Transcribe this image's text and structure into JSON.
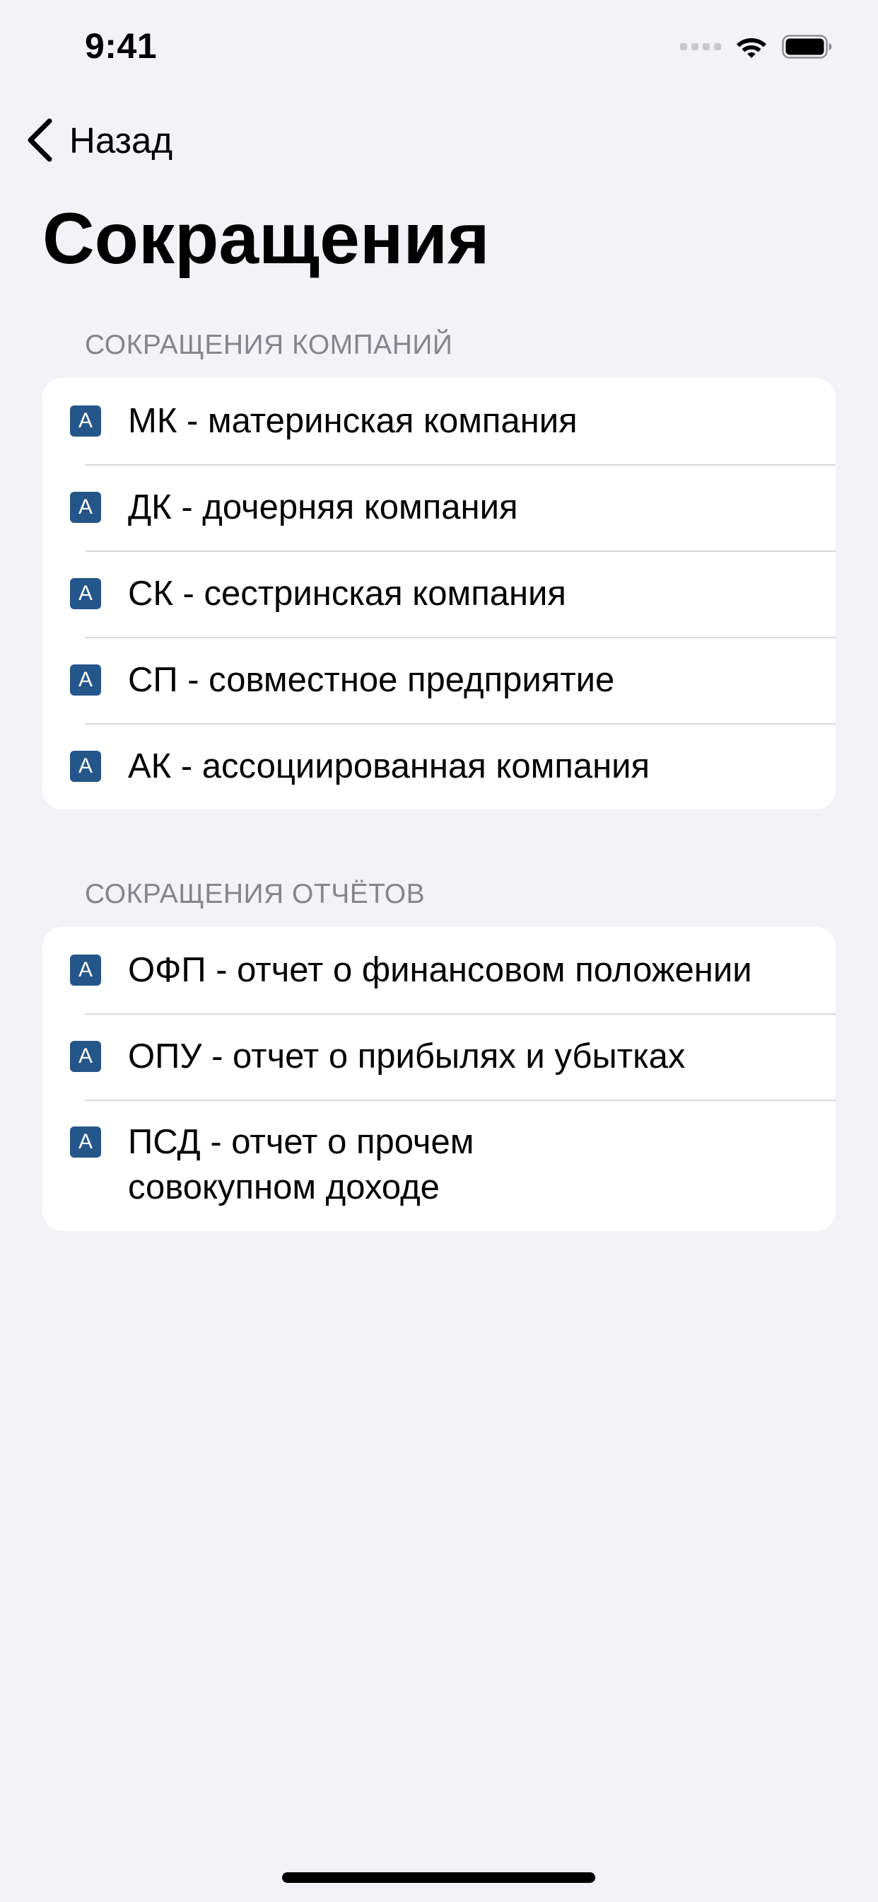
{
  "status_bar": {
    "time": "9:41"
  },
  "nav": {
    "back_label": "Назад"
  },
  "title": "Сокращения",
  "badge_letter": "A",
  "sections": [
    {
      "header": "Сокращения компаний",
      "items": [
        "МК - материнская компания",
        "ДК - дочерняя компания",
        "СК - сестринская компания",
        "СП - совместное предприятие",
        "АК - ассоциированная компания"
      ]
    },
    {
      "header": "Сокращения отчётов",
      "items": [
        "ОФП - отчет о финансовом положении",
        "ОПУ - отчет о прибылях и убытках",
        "ПСД - отчет о прочем совокупном доходе"
      ]
    }
  ],
  "icons": {
    "back": "chevron-left-icon",
    "wifi": "wifi-icon",
    "battery": "battery-icon",
    "signal": "cellular-signal-icon"
  },
  "colors": {
    "background": "#f2f2f7",
    "card": "#ffffff",
    "badge": "#24568a",
    "section_header": "#85858b",
    "separator": "#d9d9de"
  }
}
